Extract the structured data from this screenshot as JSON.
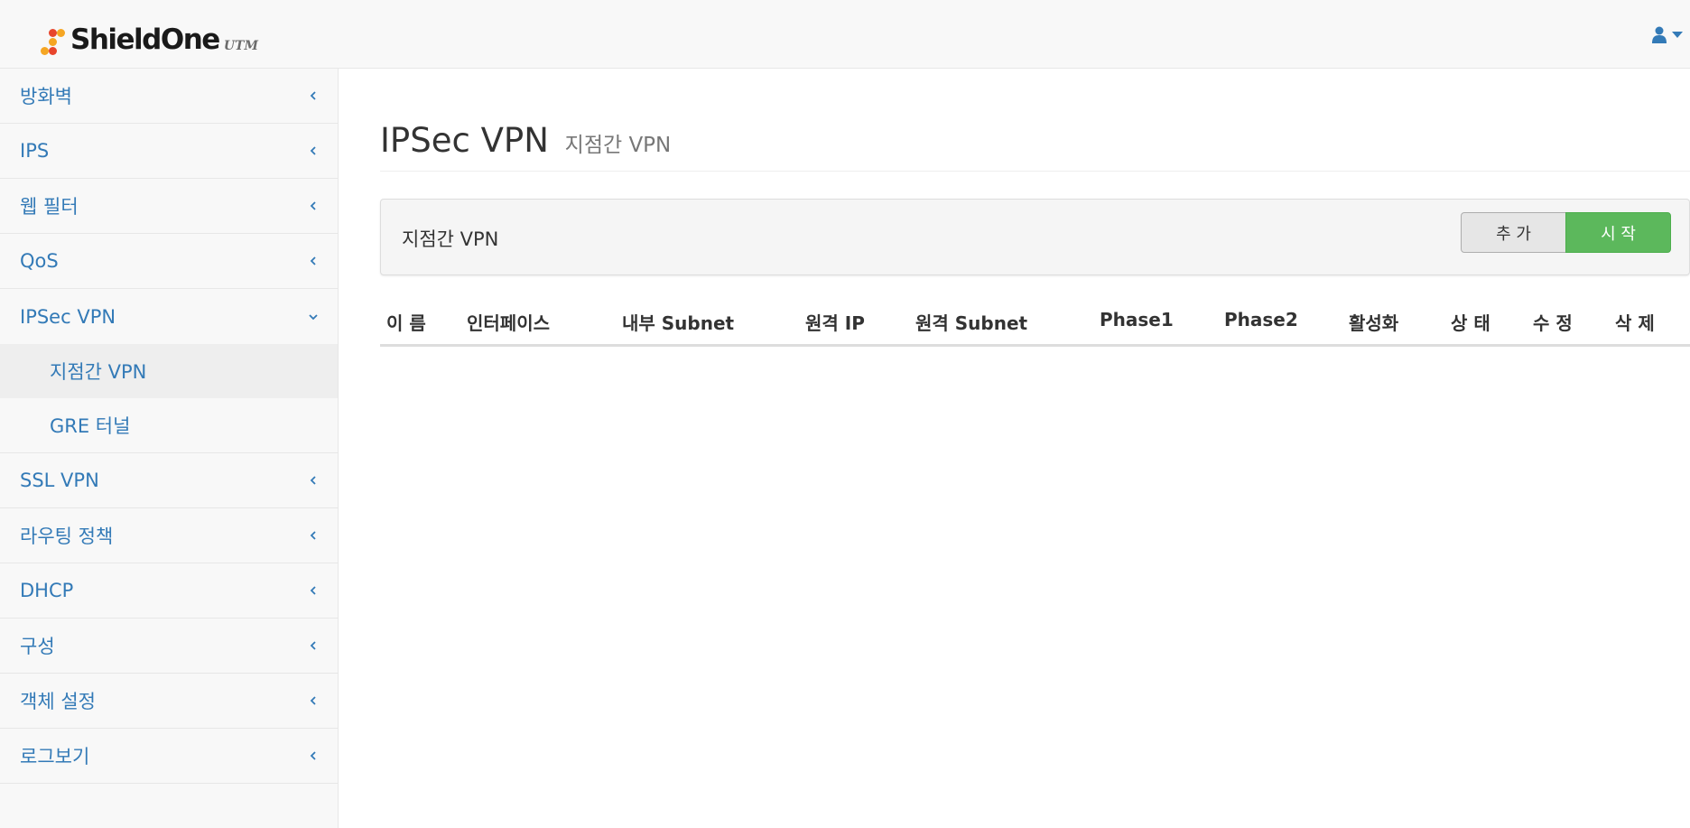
{
  "header": {
    "logo_text": "ShieldOne",
    "logo_sub": "UTM",
    "logo_dot_colors": [
      "#e8452c",
      "#f5a623",
      "#f5a623",
      "#e8452c",
      "#f5a623"
    ],
    "user_icon": "user-icon",
    "caret_icon": "caret-down-icon"
  },
  "sidebar": {
    "items": [
      {
        "label": "방화벽",
        "icon": "chevron-left-icon"
      },
      {
        "label": "IPS",
        "icon": "chevron-left-icon"
      },
      {
        "label": "웹 필터",
        "icon": "chevron-left-icon"
      },
      {
        "label": "QoS",
        "icon": "chevron-left-icon"
      },
      {
        "label": "IPSec VPN",
        "icon": "chevron-down-icon",
        "expanded": true,
        "children": [
          {
            "label": "지점간 VPN",
            "active": true
          },
          {
            "label": "GRE 터널"
          }
        ]
      },
      {
        "label": "SSL VPN",
        "icon": "chevron-left-icon"
      },
      {
        "label": "라우팅 정책",
        "icon": "chevron-left-icon"
      },
      {
        "label": "DHCP",
        "icon": "chevron-left-icon"
      },
      {
        "label": "구성",
        "icon": "chevron-left-icon"
      },
      {
        "label": "객체 설정",
        "icon": "chevron-left-icon"
      },
      {
        "label": "로그보기",
        "icon": "chevron-left-icon"
      }
    ]
  },
  "main": {
    "title": "IPSec VPN",
    "subtitle": "지점간 VPN",
    "panel": {
      "title": "지점간 VPN",
      "add_label": "추 가",
      "start_label": "시 작"
    },
    "table": {
      "columns": [
        "이 름",
        "인터페이스",
        "내부 Subnet",
        "원격 IP",
        "원격 Subnet",
        "Phase1",
        "Phase2",
        "활성화",
        "상 태",
        "수 정",
        "삭 제"
      ],
      "rows": []
    }
  },
  "colors": {
    "link": "#337ab7",
    "success": "#5cb85c",
    "text": "#333333"
  }
}
